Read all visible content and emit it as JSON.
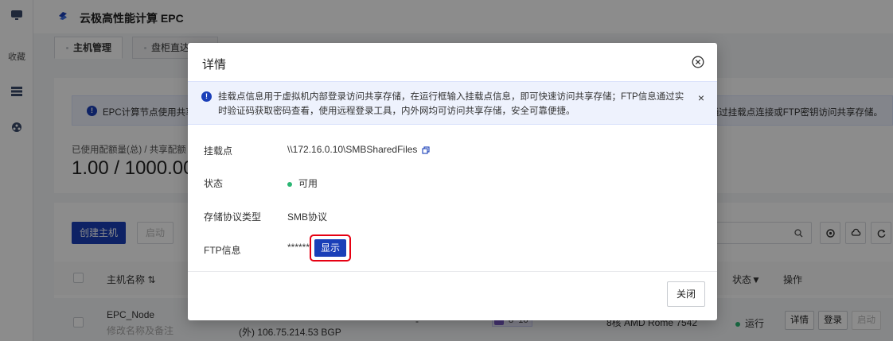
{
  "sidebar": {
    "favorites_label": "收藏"
  },
  "app": {
    "title": "云极高性能计算 EPC"
  },
  "tabs": [
    {
      "label": "主机管理"
    },
    {
      "label": "盘柜直达"
    }
  ],
  "notice": {
    "text": "EPC计算节点使用共享",
    "text_right": "通过挂载点连接或FTP密钥访问共享存储。"
  },
  "quota": {
    "label": "已使用配额量(总) / 共享配额",
    "value": "1.00 / 1000.00"
  },
  "toolbar": {
    "create_label": "创建主机",
    "start_label": "启动"
  },
  "table": {
    "headers": {
      "name": "主机名称",
      "status": "状态",
      "ops": "操作"
    },
    "rows": [
      {
        "name": "EPC_Node",
        "subtitle": "修改名称及备注",
        "ip": "(外) 106.75.214.53 BGP",
        "dash": "-",
        "badge_a": "8",
        "badge_b": "16",
        "cpu": "8核 AMD Rome 7542",
        "status": "运行",
        "ops": [
          "详情",
          "登录",
          "启动"
        ]
      }
    ]
  },
  "modal": {
    "title": "详情",
    "notice": "挂载点信息用于虚拟机内部登录访问共享存储，在运行框输入挂载点信息，即可快速访问共享存储；FTP信息通过实时验证码获取密码查看，使用远程登录工具，内外网均可访问共享存储，安全可靠便捷。",
    "fields": [
      {
        "label": "挂载点",
        "value": "\\\\172.16.0.10\\SMBSharedFiles"
      },
      {
        "label": "状态",
        "value": "可用"
      },
      {
        "label": "存储协议类型",
        "value": "SMB协议"
      },
      {
        "label": "FTP信息",
        "value": "******"
      }
    ],
    "show_label": "显示",
    "close_label": "关闭"
  },
  "colors": {
    "primary": "#1a3fb8",
    "success": "#2bb673",
    "highlight": "#e60012"
  }
}
